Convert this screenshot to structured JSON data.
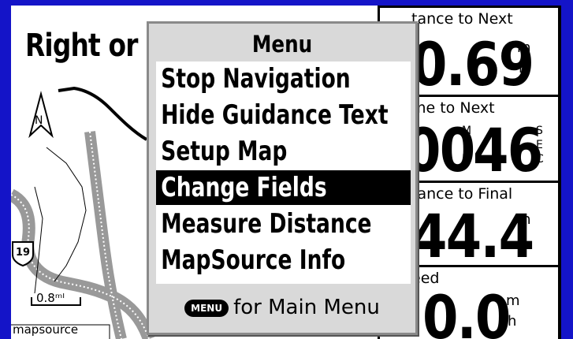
{
  "map": {
    "title": "Right or",
    "scale_label": "0.8ᵐᴵ",
    "source_label": "mapsource",
    "route_shield": "19"
  },
  "fields": [
    {
      "label": "tance to Next",
      "value": "0.69",
      "unit_top": "m",
      "unit_bottom": "i"
    },
    {
      "label": "me to Next",
      "value": "00",
      "unit_mid1": "M",
      "unit_mid2": "I",
      "unit_mid3": "N",
      "value2": "46",
      "unit_s1": "S",
      "unit_s2": "E",
      "unit_s3": "C"
    },
    {
      "label": "tance to Final",
      "value": "44.4",
      "unit_top": "m",
      "unit_bottom": "i"
    },
    {
      "label": "eed",
      "value": "0.0",
      "unit_top": "m",
      "unit_bottom": "h"
    }
  ],
  "menu": {
    "title": "Menu",
    "items": [
      {
        "label": "Stop Navigation",
        "selected": false
      },
      {
        "label": "Hide Guidance Text",
        "selected": false
      },
      {
        "label": "Setup Map",
        "selected": false
      },
      {
        "label": "Change Fields",
        "selected": true
      },
      {
        "label": "Measure Distance",
        "selected": false
      },
      {
        "label": "MapSource Info",
        "selected": false
      }
    ],
    "key_label": "MENU",
    "hint": "for Main Menu"
  }
}
